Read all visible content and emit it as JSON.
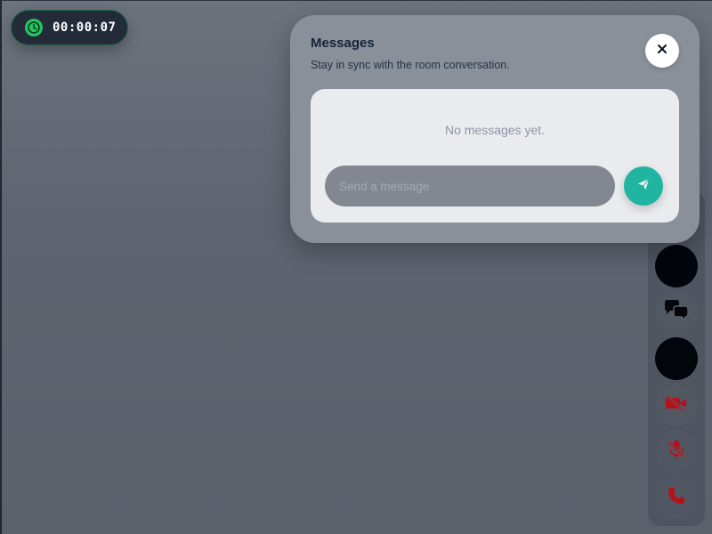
{
  "timer": {
    "elapsed": "00:00:07",
    "icon": "clock-icon",
    "accent_color": "#22c55e"
  },
  "messages_panel": {
    "title": "Messages",
    "subtitle": "Stay in sync with the room conversation.",
    "close_icon": "close-icon",
    "empty_state": "No messages yet.",
    "input_placeholder": "Send a message",
    "send_icon": "send-icon",
    "send_color": "#1fb5a0"
  },
  "controls": [
    {
      "name": "control-dark-1",
      "icon": "none"
    },
    {
      "name": "chat-button",
      "icon": "chat-bubbles-icon"
    },
    {
      "name": "control-dark-2",
      "icon": "none"
    },
    {
      "name": "camera-off-button",
      "icon": "video-off-icon",
      "color": "#b3121b"
    },
    {
      "name": "mic-off-button",
      "icon": "mic-off-icon",
      "color": "#b3121b"
    },
    {
      "name": "end-call-button",
      "icon": "phone-icon",
      "color": "#b3121b"
    }
  ]
}
